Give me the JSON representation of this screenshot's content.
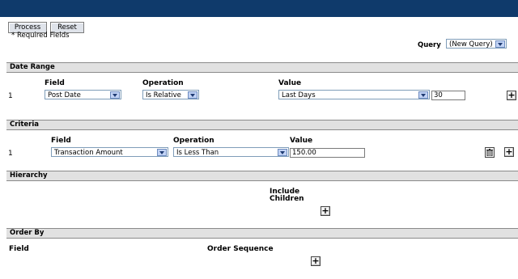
{
  "toolbar": {
    "process_label": "Process",
    "reset_label": "Reset",
    "required_note": "* Required Fields"
  },
  "query": {
    "label": "Query",
    "value": "(New Query)"
  },
  "date_range": {
    "title": "Date Range",
    "headers": {
      "field": "Field",
      "operation": "Operation",
      "value": "Value"
    },
    "row": {
      "num": "1",
      "field": "Post Date",
      "operation": "Is Relative",
      "value_select": "Last Days",
      "value_input": "30"
    }
  },
  "criteria": {
    "title": "Criteria",
    "headers": {
      "field": "Field",
      "operation": "Operation",
      "value": "Value"
    },
    "row": {
      "num": "1",
      "field": "Transaction Amount",
      "operation": "Is Less Than",
      "value_input": "150.00"
    }
  },
  "hierarchy": {
    "title": "Hierarchy",
    "include_line1": "Include",
    "include_line2": "Children"
  },
  "order_by": {
    "title": "Order By",
    "field_header": "Field",
    "sequence_header": "Order Sequence"
  },
  "icons": {
    "plus": "+"
  }
}
